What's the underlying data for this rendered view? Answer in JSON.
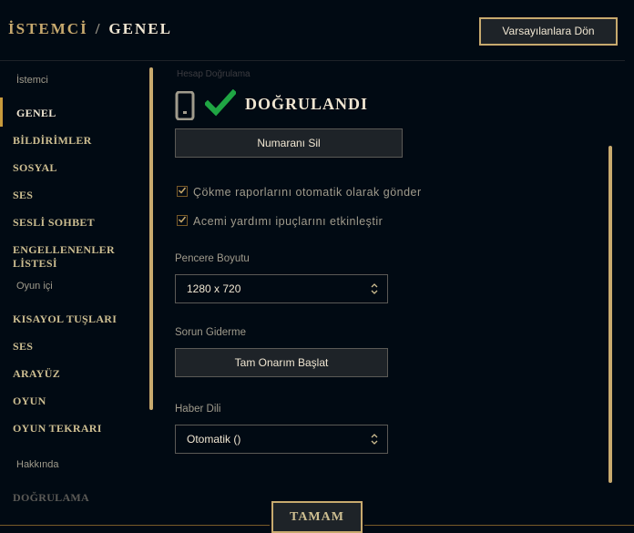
{
  "header": {
    "section": "İSTEMCİ",
    "separator": "/",
    "current": "GENEL",
    "reset_button": "Varsayılanlara Dön"
  },
  "sidebar": {
    "client_label": "İstemci",
    "client_items": [
      "GENEL",
      "BİLDİRİMLER",
      "SOSYAL",
      "SES",
      "SESLİ SOHBET",
      "ENGELLENENLER LİSTESİ"
    ],
    "ingame_label": "Oyun içi",
    "ingame_items": [
      "KISAYOL TUŞLARI",
      "SES",
      "ARAYÜZ",
      "OYUN",
      "OYUN TEKRARI"
    ],
    "about_label": "Hakkında",
    "about_items": [
      "DOĞRULAMA"
    ]
  },
  "content": {
    "faded_heading": "Hesap Doğrulama",
    "verified_text": "DOĞRULANDI",
    "remove_number_button": "Numaranı Sil",
    "checkbox_crash_reports": "Çökme raporlarını otomatik olarak gönder",
    "checkbox_crash_reports_checked": true,
    "checkbox_newbie_tips": "Acemi yardımı ipuçlarını etkinleştir",
    "checkbox_newbie_tips_checked": true,
    "window_size_label": "Pencere Boyutu",
    "window_size_value": "1280 x 720",
    "troubleshoot_label": "Sorun Giderme",
    "repair_button": "Tam Onarım Başlat",
    "news_language_label": "Haber Dili",
    "news_language_value": "Otomatik ()"
  },
  "footer": {
    "ok_button": "TAMAM"
  },
  "colors": {
    "gold": "#c8aa6e",
    "background": "#010a13",
    "check_green": "#1fa543"
  }
}
